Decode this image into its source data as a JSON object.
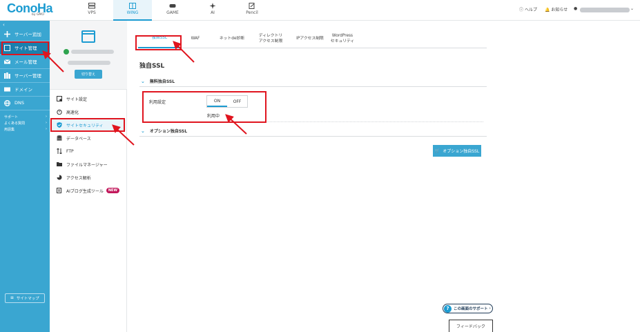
{
  "brand": {
    "logo_text": "ConoHa",
    "logo_sub": "by GMO"
  },
  "top_nav": {
    "tabs": [
      {
        "label": "VPS",
        "icon": "server-icon"
      },
      {
        "label": "WING",
        "icon": "wing-icon"
      },
      {
        "label": "GAME",
        "icon": "gamepad-icon"
      },
      {
        "label": "AI",
        "icon": "ai-icon"
      },
      {
        "label": "Pencil",
        "icon": "pencil-icon"
      }
    ],
    "help": "ヘルプ",
    "notifications": "お知らせ"
  },
  "sidebar": {
    "items": [
      {
        "label": "サーバー追加",
        "icon": "plus-icon"
      },
      {
        "label": "サイト管理",
        "icon": "site-icon"
      },
      {
        "label": "メール管理",
        "icon": "mail-icon"
      },
      {
        "label": "サーバー管理",
        "icon": "server-bars-icon"
      },
      {
        "label": "ドメイン",
        "icon": "domain-icon"
      },
      {
        "label": "DNS",
        "icon": "globe-icon"
      }
    ],
    "small_links": [
      "サポート",
      "よくある質問",
      "用語集"
    ],
    "sitemap": "サイトマップ"
  },
  "subsidebar": {
    "switch_label": "切り替え",
    "items": [
      {
        "label": "サイト設定",
        "icon": "site-settings-icon"
      },
      {
        "label": "高速化",
        "icon": "stopwatch-icon"
      },
      {
        "label": "サイトセキュリティ",
        "icon": "shield-icon"
      },
      {
        "label": "データベース",
        "icon": "database-icon"
      },
      {
        "label": "FTP",
        "icon": "transfer-icon"
      },
      {
        "label": "ファイルマネージャー",
        "icon": "folder-icon"
      },
      {
        "label": "アクセス解析",
        "icon": "pie-chart-icon"
      },
      {
        "label": "AIブログ生成ツール",
        "icon": "ai-doc-icon"
      }
    ],
    "new_badge": "NEW"
  },
  "main": {
    "tabs": [
      {
        "line1": "独自SSL",
        "line2": ""
      },
      {
        "line1": "WAF",
        "line2": ""
      },
      {
        "line1": "ネットde診断",
        "line2": ""
      },
      {
        "line1": "ディレクトリ",
        "line2": "アクセス制限"
      },
      {
        "line1": "IPアクセス制限",
        "line2": ""
      },
      {
        "line1": "WordPress",
        "line2": "セキュリティ"
      }
    ],
    "title": "独自SSL",
    "free_ssl_section": "無料独自SSL",
    "setting_label": "利用設定",
    "toggle_on": "ON",
    "toggle_off": "OFF",
    "status": "利用中",
    "option_ssl_section": "オプション独自SSL",
    "option_ssl_button": "オプション独自SSL"
  },
  "footer": {
    "support_button": "この画面のサポート",
    "feedback_button": "フィードバック"
  },
  "colors": {
    "accent": "#1b9bd1",
    "sidebar": "#3aa6d1",
    "sidebar_active": "#1a7fae",
    "annotation": "#e0141e",
    "new_badge": "#c2185b"
  }
}
